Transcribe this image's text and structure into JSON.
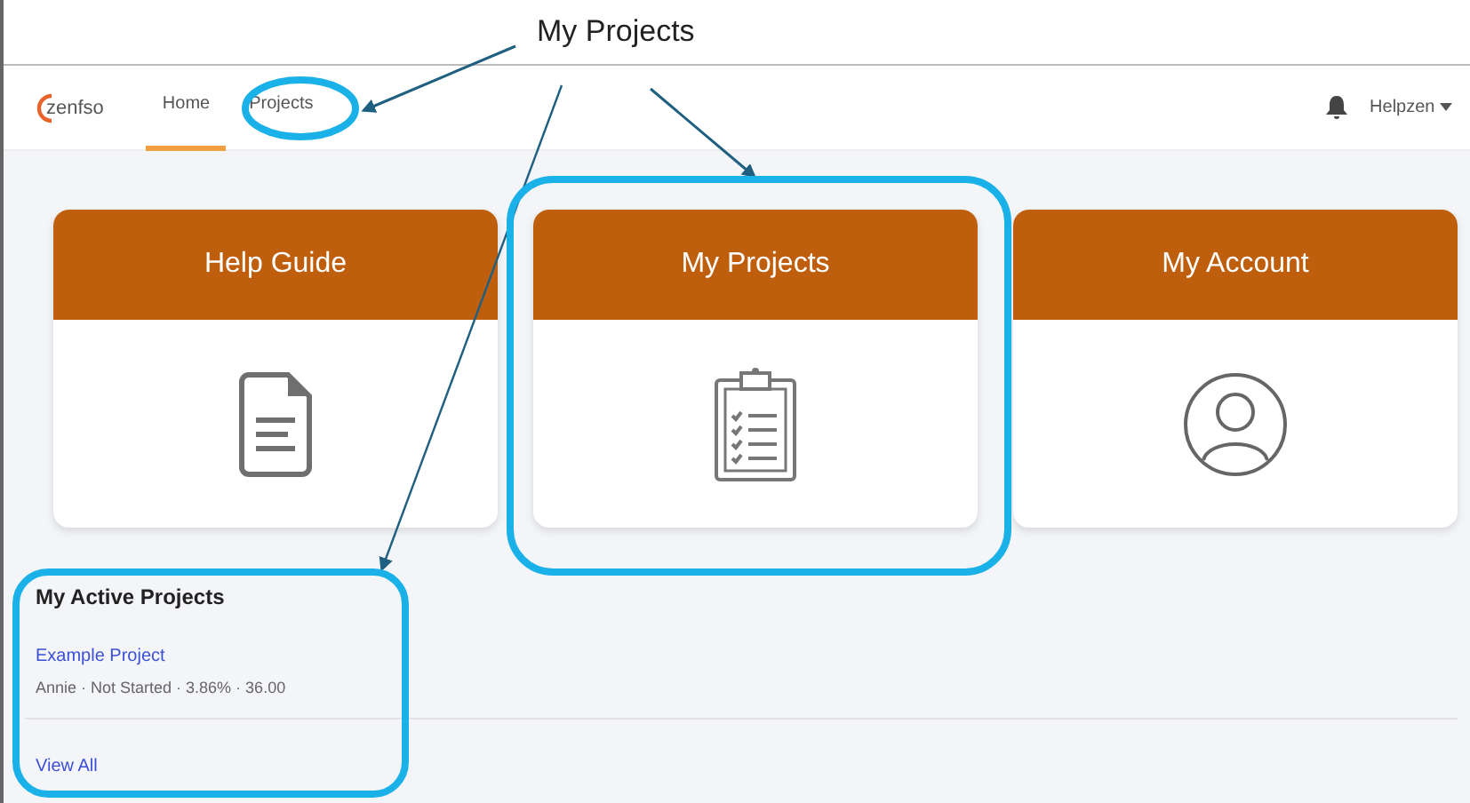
{
  "callout": {
    "text": "My Projects"
  },
  "nav": {
    "logo": "zenfso",
    "tabs": [
      {
        "label": "Home",
        "selected": true
      },
      {
        "label": "Projects",
        "selected": false
      }
    ],
    "user": "Helpzen"
  },
  "cards": [
    {
      "title": "Help Guide",
      "kind": "document"
    },
    {
      "title": "My Projects",
      "kind": "clipboard"
    },
    {
      "title": "My Account",
      "kind": "user"
    }
  ],
  "active_projects": {
    "title": "My Active Projects",
    "projects": [
      {
        "name": "Example Project",
        "meta": "Annie · Not Started · 3.86% · 36.00"
      }
    ],
    "view_all": "View All"
  }
}
